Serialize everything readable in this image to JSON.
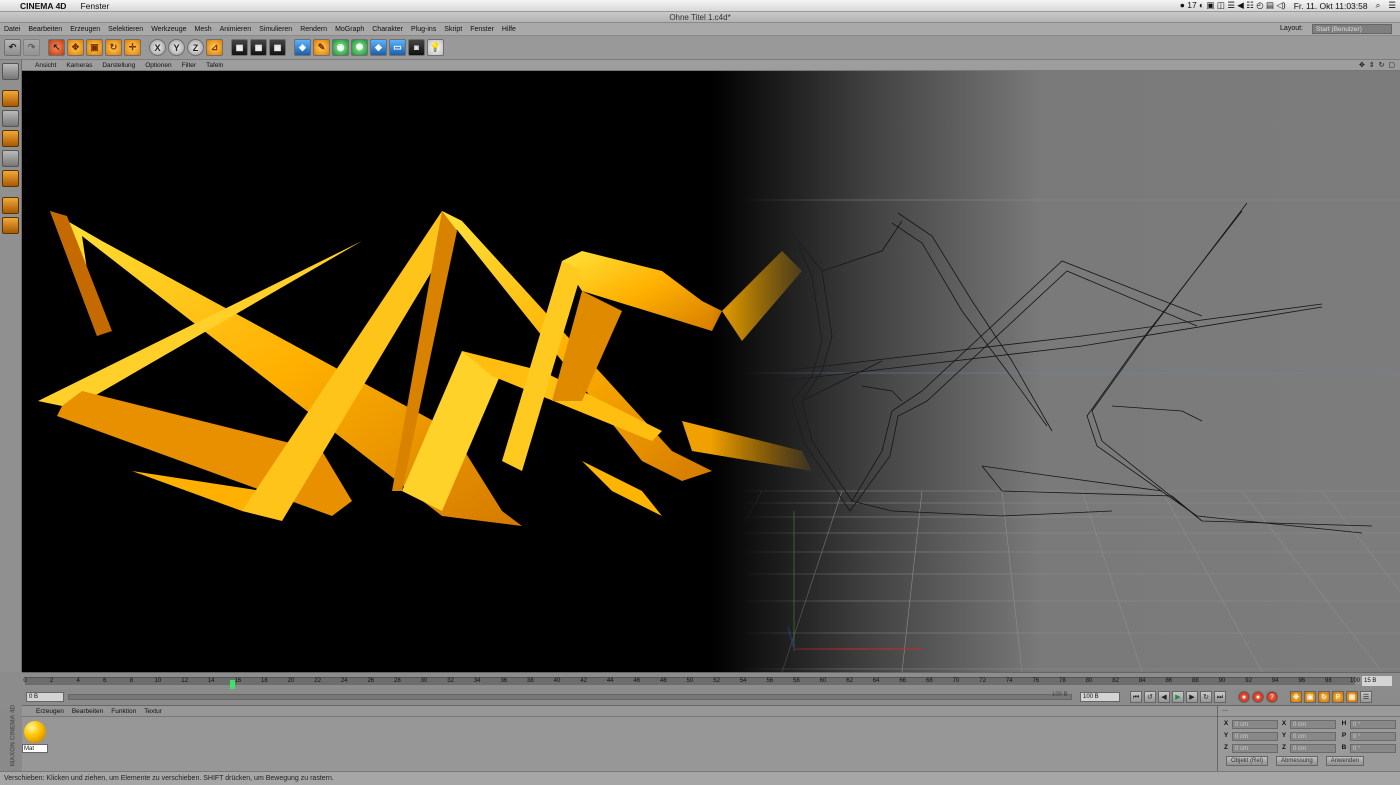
{
  "macbar": {
    "app_name": "CINEMA 4D",
    "window_menu": "Fenster",
    "date_time": "Fr. 11. Okt  11:03:58",
    "calendar_badge": "17"
  },
  "window_title": "Ohne Titel 1.c4d*",
  "menus": [
    "Datei",
    "Bearbeiten",
    "Erzeugen",
    "Selektieren",
    "Werkzeuge",
    "Mesh",
    "Animieren",
    "Simulieren",
    "Rendern",
    "MoGraph",
    "Charakter",
    "Plug-ins",
    "Skript",
    "Fenster",
    "Hilfe"
  ],
  "layout": {
    "label": "Layout:",
    "value": "Start (Benutzer)"
  },
  "toolbar": {
    "axis_x": "X",
    "axis_y": "Y",
    "axis_z": "Z"
  },
  "viewport_menu": [
    "Ansicht",
    "Kameras",
    "Darstellung",
    "Optionen",
    "Filter",
    "Tafeln"
  ],
  "timeline": {
    "ticks": [
      "0",
      "2",
      "4",
      "6",
      "8",
      "10",
      "12",
      "14",
      "16",
      "18",
      "20",
      "22",
      "24",
      "26",
      "28",
      "30",
      "32",
      "34",
      "36",
      "38",
      "40",
      "42",
      "44",
      "46",
      "48",
      "50",
      "52",
      "54",
      "56",
      "58",
      "60",
      "62",
      "64",
      "66",
      "68",
      "70",
      "72",
      "74",
      "76",
      "78",
      "80",
      "82",
      "84",
      "86",
      "88",
      "90",
      "92",
      "94",
      "96",
      "98",
      "100"
    ],
    "current_frame": "15.6",
    "end_display": "15 B",
    "current_frame_value": 15.6,
    "max": 100
  },
  "transport": {
    "current": "0 B",
    "end": "100 B",
    "range_tag": "100 B"
  },
  "materials": {
    "menu": [
      "Erzeugen",
      "Bearbeiten",
      "Funktion",
      "Textur"
    ],
    "items": [
      {
        "name": "Mat"
      }
    ]
  },
  "maxon_logo": "MAXON CINEMA 4D",
  "coords": {
    "header": "---",
    "rows": [
      {
        "a": "X",
        "av": "0 cm",
        "b": "X",
        "bv": "0 cm",
        "c": "H",
        "cv": "0 °"
      },
      {
        "a": "Y",
        "av": "0 cm",
        "b": "Y",
        "bv": "0 cm",
        "c": "P",
        "cv": "0 °"
      },
      {
        "a": "Z",
        "av": "0 cm",
        "b": "Z",
        "bv": "0 cm",
        "c": "B",
        "cv": "0 °"
      }
    ],
    "mode": "Objekt (Rel)",
    "size_mode": "Abmessung",
    "apply": "Anwenden"
  },
  "status": "Verschieben: Klicken und ziehen, um Elemente zu verschieben. SHIFT drücken, um Bewegung zu rastern.",
  "colors": {
    "shape_gold": "#ffb000",
    "shape_highlight": "#ffe23a",
    "shape_shadow": "#c46a00",
    "wire": "#1a1a1a",
    "viewport_bg": "#7b7b7b"
  }
}
